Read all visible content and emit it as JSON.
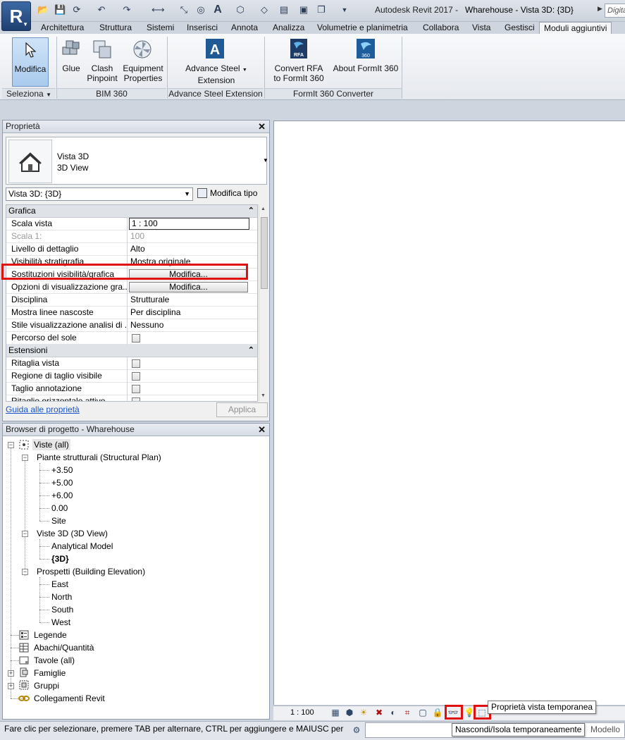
{
  "app": {
    "logo": "R",
    "title": "Autodesk Revit 2017 -",
    "document": "Wharehouse - Vista 3D: {3D}",
    "search_placeholder": "Digita"
  },
  "tabs": [
    {
      "label": "Architettura"
    },
    {
      "label": "Struttura"
    },
    {
      "label": "Sistemi"
    },
    {
      "label": "Inserisci"
    },
    {
      "label": "Annota"
    },
    {
      "label": "Analizza"
    },
    {
      "label": "Volumetrie e planimetria"
    },
    {
      "label": "Collabora"
    },
    {
      "label": "Vista"
    },
    {
      "label": "Gestisci"
    },
    {
      "label": "Moduli aggiuntivi",
      "active": true
    }
  ],
  "ribbon": {
    "modifica": "Modifica",
    "seleziona": "Seleziona",
    "glue": "Glue",
    "clash_1": "Clash",
    "clash_2": "Pinpoint",
    "equip_1": "Equipment",
    "equip_2": "Properties",
    "bim_label": "BIM 360",
    "adv_1": "Advance Steel",
    "adv_2": "Extension",
    "adv_label": "Advance Steel Extension",
    "conv_1": "Convert RFA",
    "conv_2": "to FormIt 360",
    "about": "About FormIt 360",
    "formit_label": "FormIt 360 Converter",
    "rfa_badge": "RFA",
    "fi_badge": "360"
  },
  "properties": {
    "title": "Proprietà",
    "type_name": "Vista 3D",
    "type_sub": "3D View",
    "instance": "Vista 3D: {3D}",
    "edit_type": "Modifica tipo",
    "groups": {
      "grafica": "Grafica",
      "estensioni": "Estensioni"
    },
    "rows": [
      {
        "key": "Scala vista",
        "value": "1 : 100"
      },
      {
        "key": "Scala 1:",
        "value": "100"
      },
      {
        "key": "Livello di dettaglio",
        "value": "Alto"
      },
      {
        "key": "Visibilità stratigrafia",
        "value": "Mostra originale"
      },
      {
        "key": "Sostituzioni visibilità/grafica",
        "value": "Modifica..."
      },
      {
        "key": "Opzioni di visualizzazione gra...",
        "value": "Modifica..."
      },
      {
        "key": "Disciplina",
        "value": "Strutturale"
      },
      {
        "key": "Mostra linee nascoste",
        "value": "Per disciplina"
      },
      {
        "key": "Stile visualizzazione analisi di ...",
        "value": "Nessuno"
      },
      {
        "key": "Percorso del sole",
        "value": ""
      },
      {
        "key": "Ritaglia vista",
        "value": ""
      },
      {
        "key": "Regione di taglio visibile",
        "value": ""
      },
      {
        "key": "Taglio annotazione",
        "value": ""
      },
      {
        "key": "Ritaglio orizzontale attivo",
        "value": ""
      }
    ],
    "help": "Guida alle proprietà",
    "apply": "Applica"
  },
  "browser": {
    "title": "Browser di progetto - Wharehouse",
    "views": "Viste (all)",
    "plans": "Piante strutturali (Structural Plan)",
    "plan_items": [
      "+3.50",
      "+5.00",
      "+6.00",
      "0.00",
      "Site"
    ],
    "views3d": "Viste 3D (3D View)",
    "views3d_items": [
      "Analytical Model",
      "{3D}"
    ],
    "elevations": "Prospetti (Building Elevation)",
    "elevation_items": [
      "East",
      "North",
      "South",
      "West"
    ],
    "legends": "Legende",
    "schedules": "Abachi/Quantità",
    "sheets": "Tavole (all)",
    "families": "Famiglie",
    "groups": "Gruppi",
    "links": "Collegamenti Revit"
  },
  "viewbar": {
    "scale": "1 : 100",
    "tooltip_temp": "Proprietà vista temporanea",
    "tooltip_hide": "Nascondi/Isola temporaneamente"
  },
  "status": {
    "text": "Fare clic per selezionare, premere TAB per alternare, CTRL per aggiungere e MAIUSC per des",
    "model": "Modello"
  },
  "colors": {
    "highlight": "#e01010",
    "accent": "#1e3f70"
  }
}
